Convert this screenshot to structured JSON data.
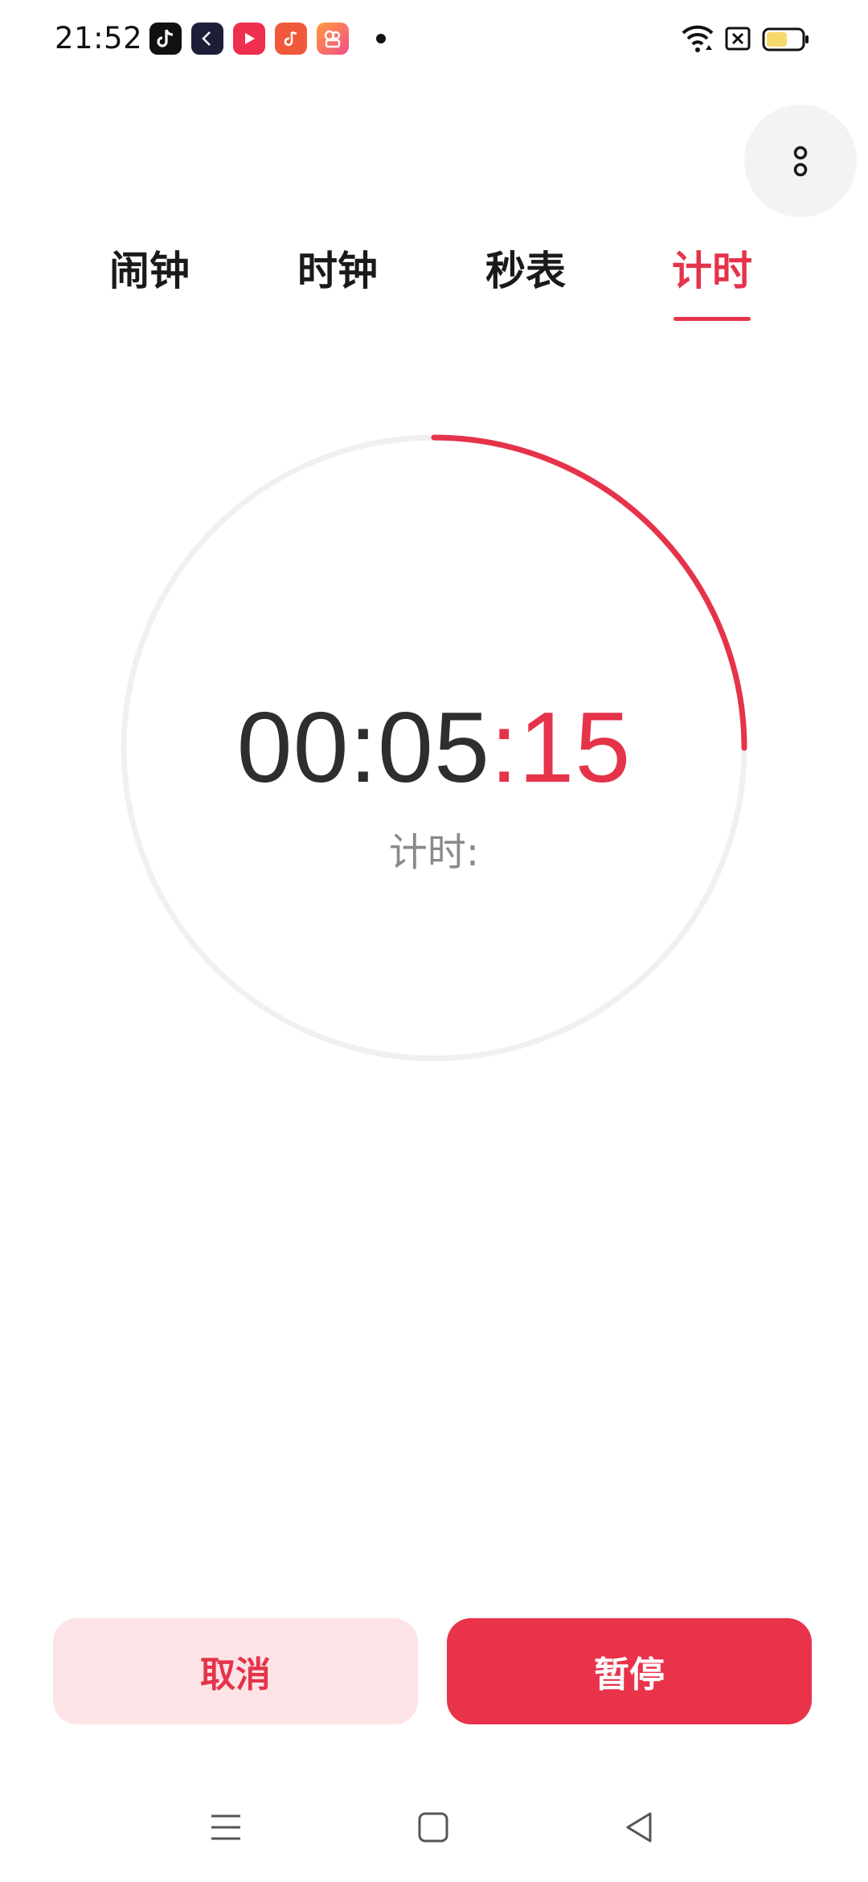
{
  "status_bar": {
    "time": "21:52",
    "app_icons": [
      "tiktok-icon",
      "back-app-icon",
      "video-play-icon",
      "music-icon",
      "camera-app-icon"
    ],
    "right_icons": [
      "wifi-icon",
      "sim-disabled-icon",
      "battery-icon"
    ],
    "battery_level": 0.6
  },
  "tabs": [
    {
      "label": "闹钟",
      "active": false
    },
    {
      "label": "时钟",
      "active": false
    },
    {
      "label": "秒表",
      "active": false
    },
    {
      "label": "计时",
      "active": true
    }
  ],
  "timer": {
    "hours_minutes": "00:05",
    "seconds": ":15",
    "caption": "计时:",
    "progress_fraction": 0.25
  },
  "actions": {
    "cancel_label": "取消",
    "pause_label": "暂停"
  },
  "colors": {
    "accent": "#e5334a",
    "cancel_bg": "#fce3e5",
    "ring_track": "#f0f0f0"
  },
  "nav": [
    "menu-icon",
    "home-icon",
    "back-icon"
  ]
}
